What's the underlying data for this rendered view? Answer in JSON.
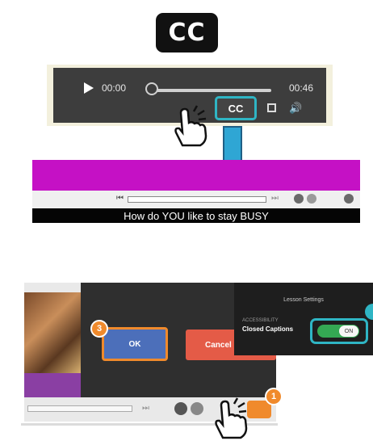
{
  "cc_badge": {
    "label": "CC"
  },
  "top_player": {
    "current_time": "00:00",
    "duration": "00:46",
    "cc_label": "CC"
  },
  "middle_player": {
    "caption": "How do YOU like to stay BUSY"
  },
  "bottom_player": {
    "ok_label": "OK",
    "cancel_label": "Cancel",
    "step_ok": "3",
    "step_settings": "1"
  },
  "settings_panel": {
    "title": "Lesson Settings",
    "section_label": "ACCESSIBILITY",
    "closed_captions_label": "Closed Captions",
    "toggle_label": "ON",
    "toggle_on": true
  },
  "colors": {
    "highlight_teal": "#2fb5c4",
    "step_orange": "#f08a2c",
    "arrow_blue": "#2fa6d4",
    "video_magenta": "#c511c5"
  },
  "icons": [
    "play-icon",
    "fullscreen-icon",
    "volume-icon",
    "pointing-hand-icon",
    "down-arrow-icon",
    "settings-gear-icon"
  ]
}
